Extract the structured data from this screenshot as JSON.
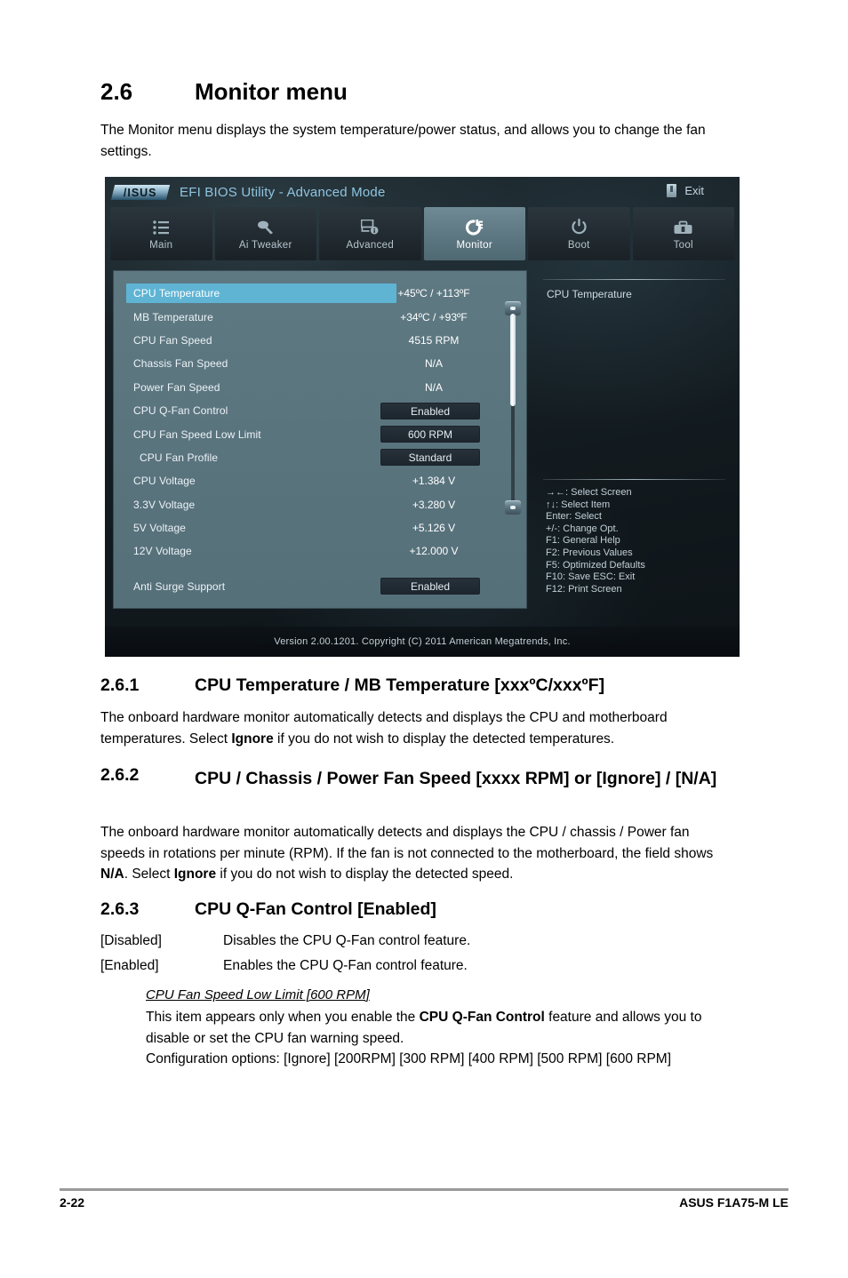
{
  "doc": {
    "section": {
      "number": "2.6",
      "title": "Monitor menu",
      "intro": "The Monitor menu displays the system temperature/power status, and allows you to change the fan settings."
    },
    "sub1": {
      "number": "2.6.1",
      "title": "CPU Temperature / MB Temperature [xxxºC/xxxºF]",
      "body_1": "The onboard hardware monitor automatically detects and displays the CPU and motherboard temperatures. Select ",
      "body_bold": "Ignore",
      "body_2": " if you do not wish to display the detected temperatures."
    },
    "sub2": {
      "number": "2.6.2",
      "title": "CPU / Chassis / Power Fan Speed [xxxx RPM] or [Ignore] / [N/A]",
      "body_1": "The onboard hardware monitor automatically detects and displays the CPU / chassis / Power fan speeds in rotations per minute (RPM). If the fan is not connected to the motherboard, the field shows ",
      "body_bold_1": "N/A",
      "body_2": ". Select ",
      "body_bold_2": "Ignore",
      "body_3": " if you do not wish to display the detected speed."
    },
    "sub3": {
      "number": "2.6.3",
      "title": "CPU Q-Fan Control [Enabled]",
      "options": [
        {
          "term": "[Disabled]",
          "desc": "Disables the CPU Q-Fan control feature."
        },
        {
          "term": "[Enabled]",
          "desc": "Enables the CPU Q-Fan control feature."
        }
      ],
      "sub_item_title": "CPU Fan Speed Low Limit [600 RPM]",
      "sub_item_body_1": "This item appears only when you enable the ",
      "sub_item_bold": "CPU Q-Fan Control",
      "sub_item_body_2": " feature and allows you to disable or set the CPU fan warning speed.",
      "config_options": "Configuration options: [Ignore] [200RPM] [300 RPM] [400 RPM] [500 RPM] [600 RPM]"
    },
    "footer": {
      "page_number": "2-22",
      "product": "ASUS F1A75-M LE"
    }
  },
  "bios": {
    "brand": "/ISUS",
    "title": "EFI BIOS Utility - Advanced Mode",
    "exit_label": "Exit",
    "tabs": [
      {
        "label": "Main",
        "icon": "list-icon",
        "active": false
      },
      {
        "label": "Ai  Tweaker",
        "icon": "tweaker-icon",
        "active": false
      },
      {
        "label": "Advanced",
        "icon": "advanced-icon",
        "active": false
      },
      {
        "label": "Monitor",
        "icon": "monitor-icon",
        "active": true
      },
      {
        "label": "Boot",
        "icon": "power-icon",
        "active": false
      },
      {
        "label": "Tool",
        "icon": "tool-icon",
        "active": false
      }
    ],
    "rows": [
      {
        "label": "CPU Temperature",
        "value": "+45ºC / +113ºF",
        "type": "value",
        "selected": true,
        "indent": false
      },
      {
        "label": "MB Temperature",
        "value": "+34ºC / +93ºF",
        "type": "value",
        "selected": false,
        "indent": false
      },
      {
        "label": "CPU Fan Speed",
        "value": "4515 RPM",
        "type": "value",
        "selected": false,
        "indent": false
      },
      {
        "label": "Chassis Fan Speed",
        "value": "N/A",
        "type": "value",
        "selected": false,
        "indent": false
      },
      {
        "label": "Power Fan Speed",
        "value": "N/A",
        "type": "value",
        "selected": false,
        "indent": false
      },
      {
        "label": "CPU Q-Fan Control",
        "value": "Enabled",
        "type": "option",
        "selected": false,
        "indent": false
      },
      {
        "label": "CPU Fan Speed Low Limit",
        "value": "600 RPM",
        "type": "option",
        "selected": false,
        "indent": false
      },
      {
        "label": "CPU Fan Profile",
        "value": "Standard",
        "type": "option",
        "selected": false,
        "indent": true
      },
      {
        "label": "CPU Voltage",
        "value": "+1.384 V",
        "type": "value",
        "selected": false,
        "indent": false
      },
      {
        "label": "3.3V Voltage",
        "value": "+3.280 V",
        "type": "value",
        "selected": false,
        "indent": false
      },
      {
        "label": "5V Voltage",
        "value": "+5.126 V",
        "type": "value",
        "selected": false,
        "indent": false
      },
      {
        "label": "12V Voltage",
        "value": "+12.000 V",
        "type": "value",
        "selected": false,
        "indent": false
      },
      {
        "label": "",
        "value": "",
        "type": "spacer",
        "selected": false,
        "indent": false
      },
      {
        "label": "Anti Surge Support",
        "value": "Enabled",
        "type": "option",
        "selected": false,
        "indent": false
      }
    ],
    "help": {
      "title": "CPU Temperature",
      "keys": [
        "→←:  Select Screen",
        "↑↓:  Select Item",
        "Enter:  Select",
        "+/-:  Change Opt.",
        "F1:  General Help",
        "F2:  Previous Values",
        "F5:  Optimized Defaults",
        "F10:  Save    ESC:  Exit",
        "F12:  Print Screen"
      ]
    },
    "version": "Version  2.00.1201.   Copyright  (C)  2011  American  Megatrends,  Inc.",
    "colors": {
      "accent_selected": "#5fb4d4",
      "title_text": "#8fc4e0",
      "panel_bg": "#5b757f"
    }
  }
}
